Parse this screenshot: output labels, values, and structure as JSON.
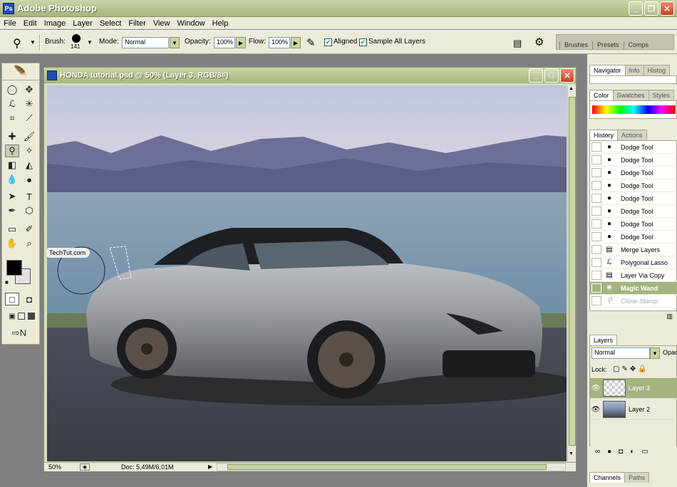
{
  "window": {
    "title": "Adobe Photoshop",
    "app_icon": "Ps"
  },
  "menu": [
    "File",
    "Edit",
    "Image",
    "Layer",
    "Select",
    "Filter",
    "View",
    "Window",
    "Help"
  ],
  "options": {
    "brush_label": "Brush:",
    "brush_size": "141",
    "mode_label": "Mode:",
    "mode_value": "Normal",
    "opacity_label": "Opacity:",
    "opacity_value": "100%",
    "flow_label": "Flow:",
    "flow_value": "100%",
    "aligned_label": "Aligned",
    "aligned_checked": true,
    "sample_all_label": "Sample All Layers",
    "sample_all_checked": true,
    "palette_well_tabs": [
      "Brushes",
      "Presets",
      "Comps"
    ]
  },
  "document": {
    "title": "HONDA tutorial.psd @ 50% (Layer 3, RGB/8#)",
    "zoom": "50%",
    "doc_size": "Doc: 5,49M/6,01M",
    "watermark": "TechTut.com"
  },
  "panels": {
    "navigator_tabs": [
      "Navigator",
      "Info",
      "Histog"
    ],
    "color_tabs": [
      "Color",
      "Swatches",
      "Styles"
    ],
    "history_tabs": [
      "History",
      "Actions"
    ],
    "history_items": [
      {
        "label": "Dodge Tool",
        "icon": "dodge-icon",
        "state": "normal"
      },
      {
        "label": "Dodge Tool",
        "icon": "dodge-icon",
        "state": "normal"
      },
      {
        "label": "Dodge Tool",
        "icon": "dodge-icon",
        "state": "normal"
      },
      {
        "label": "Dodge Tool",
        "icon": "dodge-icon",
        "state": "normal"
      },
      {
        "label": "Dodge Tool",
        "icon": "dodge-icon",
        "state": "normal"
      },
      {
        "label": "Dodge Tool",
        "icon": "dodge-icon",
        "state": "normal"
      },
      {
        "label": "Dodge Tool",
        "icon": "dodge-icon",
        "state": "normal"
      },
      {
        "label": "Dodge Tool",
        "icon": "dodge-icon",
        "state": "normal"
      },
      {
        "label": "Merge Layers",
        "icon": "merge-icon",
        "state": "normal"
      },
      {
        "label": "Polygonal Lasso",
        "icon": "lasso-icon",
        "state": "normal"
      },
      {
        "label": "Layer Via Copy",
        "icon": "layer-copy-icon",
        "state": "normal"
      },
      {
        "label": "Magic Wand",
        "icon": "magic-wand-icon",
        "state": "selected"
      },
      {
        "label": "Clone Stamp",
        "icon": "clone-stamp-icon",
        "state": "dimmed"
      }
    ],
    "layers_tab": "Layers",
    "layers_blend": "Normal",
    "layers_opacity_label": "Opac",
    "lock_label": "Lock:",
    "layers": [
      {
        "name": "Layer 3",
        "selected": true
      },
      {
        "name": "Layer 2",
        "selected": false
      }
    ],
    "bottom_tabs": [
      "Channels",
      "Paths"
    ]
  },
  "colors": {
    "chrome": "#c9d5a6",
    "selection": "#a5b47f",
    "panel_bg": "#ecebd9",
    "close": "#c4431f"
  }
}
